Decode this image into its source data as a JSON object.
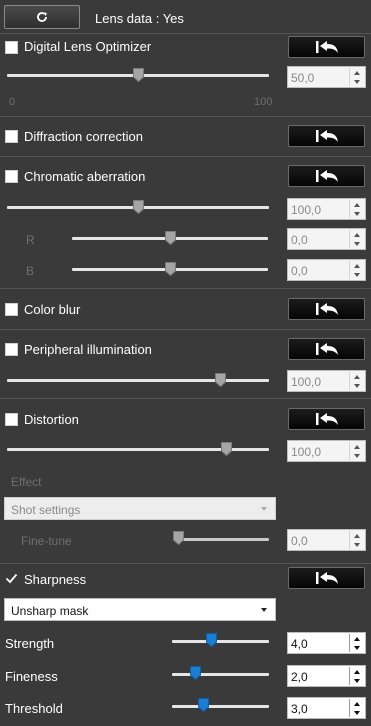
{
  "header": {
    "lens_data_label": "Lens data : Yes"
  },
  "dlo": {
    "label": "Digital Lens Optimizer",
    "checked": false,
    "value": "50,0",
    "scale_min": "0",
    "scale_max": "100"
  },
  "diffraction": {
    "label": "Diffraction correction",
    "checked": false
  },
  "chromatic": {
    "label": "Chromatic aberration",
    "checked": false,
    "value": "100,0",
    "r_label": "R",
    "r_value": "0,0",
    "b_label": "B",
    "b_value": "0,0"
  },
  "color_blur": {
    "label": "Color blur",
    "checked": false
  },
  "peripheral": {
    "label": "Peripheral illumination",
    "checked": false,
    "value": "100,0"
  },
  "distortion": {
    "label": "Distortion",
    "checked": false,
    "value": "100,0",
    "effect_label": "Effect",
    "effect_selected": "Shot settings",
    "finetune_label": "Fine-tune",
    "finetune_value": "0,0"
  },
  "sharpness": {
    "label": "Sharpness",
    "checked": true,
    "mode_selected": "Unsharp mask",
    "strength_label": "Strength",
    "strength_value": "4,0",
    "fineness_label": "Fineness",
    "fineness_value": "2,0",
    "threshold_label": "Threshold",
    "threshold_value": "3,0"
  },
  "icons": {
    "refresh": "refresh-icon",
    "reset": "reset-arrow-icon",
    "checkmark": "checkmark-icon"
  },
  "colors": {
    "panel_bg": "#3a3a3a",
    "active_thumb": "#1a7fd4",
    "separator": "#555555"
  }
}
